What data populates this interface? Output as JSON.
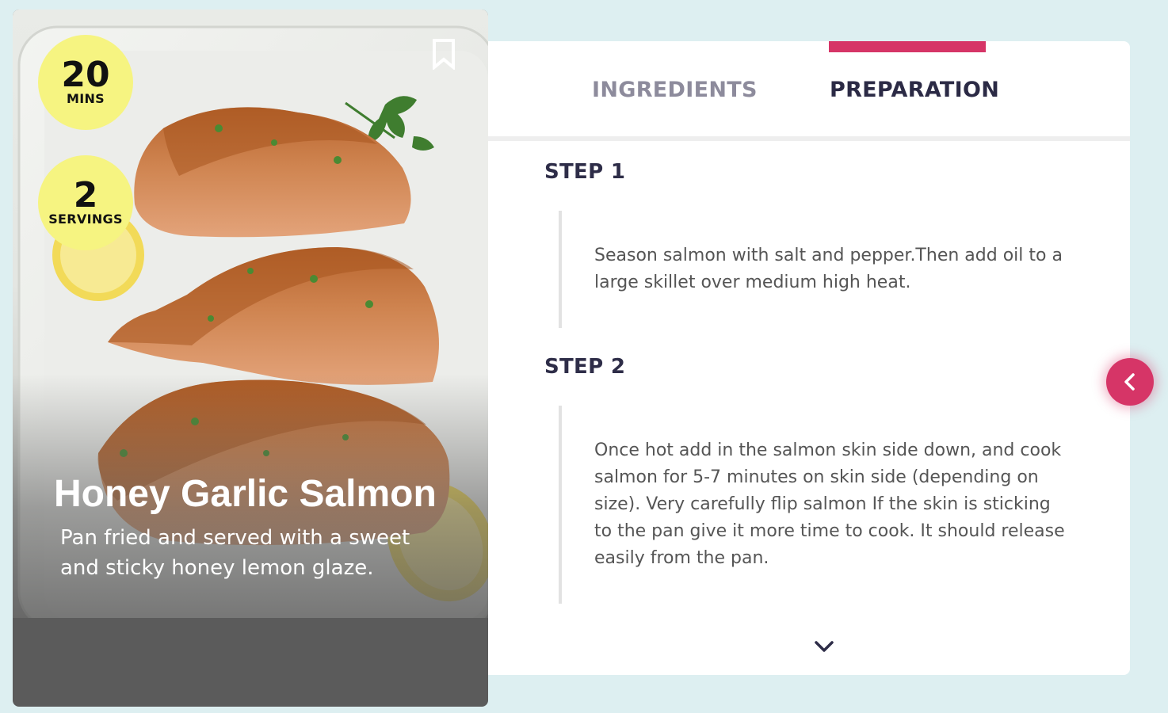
{
  "recipe": {
    "title": "Honey Garlic Salmon",
    "description": "Pan fried and served with a sweet and sticky honey lemon glaze.",
    "time": {
      "value": "20",
      "unit": "MINS"
    },
    "servings": {
      "value": "2",
      "unit": "SERVINGS"
    }
  },
  "tabs": {
    "ingredients": "INGREDIENTS",
    "preparation": "PREPARATION",
    "active": "preparation"
  },
  "steps": [
    {
      "title": "STEP 1",
      "text": "Season salmon with salt and pepper.Then add oil to a large skillet over medium high heat."
    },
    {
      "title": "STEP 2",
      "text": "Once hot add in the salmon skin side down, and cook salmon for 5-7 minutes on skin side (depending on size). Very carefully flip salmon If the skin is sticking to the pan give it more time to cook. It should release easily from the pan."
    }
  ],
  "colors": {
    "accent": "#d63567",
    "badge": "#f6f481",
    "background": "#ddeff1"
  },
  "icons": {
    "bookmark": "bookmark-icon",
    "chevron_down": "chevron-down-icon",
    "chevron_left": "chevron-left-icon"
  }
}
